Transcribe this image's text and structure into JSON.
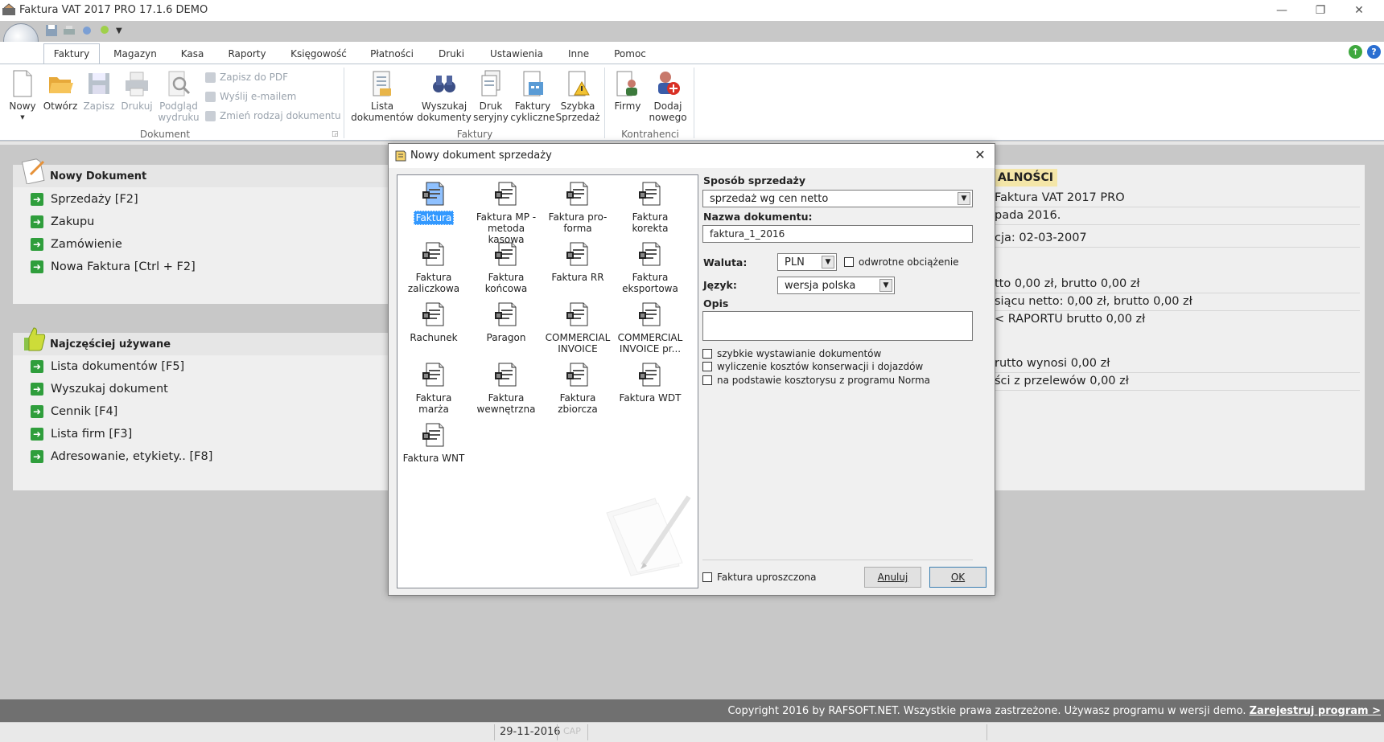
{
  "window": {
    "title": "Faktura VAT 2017 PRO 17.1.6 DEMO",
    "minimize": "—",
    "restore": "❐",
    "close": "✕"
  },
  "ribbon_tabs": [
    "Faktury",
    "Magazyn",
    "Kasa",
    "Raporty",
    "Księgowość",
    "Płatności",
    "Druki",
    "Ustawienia",
    "Inne",
    "Pomoc"
  ],
  "ribbon": {
    "dokument": {
      "label": "Dokument",
      "nowy": "Nowy",
      "otworz": "Otwórz",
      "zapisz": "Zapisz",
      "drukuj": "Drukuj",
      "podglad_1": "Podgląd",
      "podglad_2": "wydruku",
      "pdf": "Zapisz do PDF",
      "email": "Wyślij e-mailem",
      "zmien": "Zmień rodzaj dokumentu"
    },
    "faktury": {
      "label": "Faktury",
      "lista_1": "Lista",
      "lista_2": "dokumentów",
      "wyszukaj_1": "Wyszukaj",
      "wyszukaj_2": "dokumenty",
      "druk_1": "Druk",
      "druk_2": "seryjny",
      "cykliczne_1": "Faktury",
      "cykliczne_2": "cykliczne",
      "szybka_1": "Szybka",
      "szybka_2": "Sprzedaż"
    },
    "kontrahenci": {
      "label": "Kontrahenci",
      "firmy": "Firmy",
      "dodaj_1": "Dodaj",
      "dodaj_2": "nowego"
    }
  },
  "nowy_dokument": {
    "title": "Nowy Dokument",
    "items": [
      "Sprzedaży [F2]",
      "Zakupu",
      "Zamówienie",
      "Nowa Faktura [Ctrl + F2]"
    ]
  },
  "najczesciej": {
    "title": "Najczęściej używane",
    "items": [
      "Lista dokumentów [F5]",
      "Wyszukaj dokument",
      "Cennik [F4]",
      "Lista firm [F3]",
      "Adresowanie, etykiety.. [F8]"
    ]
  },
  "news": {
    "head": "ALNOŚCI",
    "lines": [
      "Faktura VAT 2017 PRO",
      "pada 2016.",
      "cja: 02-03-2007",
      "tto 0,00 zł, brutto 0,00 zł",
      "siącu netto: 0,00 zł, brutto 0,00 zł",
      "< RAPORTU brutto 0,00 zł",
      "rutto wynosi 0,00 zł",
      "ści z przelewów 0,00 zł"
    ]
  },
  "dialog": {
    "title": "Nowy dokument sprzedaży",
    "doc_types": [
      "Faktura",
      "Faktura MP - metoda kasowa",
      "Faktura pro-forma",
      "Faktura korekta",
      "Faktura zaliczkowa",
      "Faktura końcowa",
      "Faktura RR",
      "Faktura eksportowa",
      "Rachunek",
      "Paragon",
      "COMMERCIAL INVOICE",
      "COMMERCIAL INVOICE pr...",
      "Faktura marża",
      "Faktura wewnętrzna",
      "Faktura zbiorcza",
      "Faktura WDT",
      "Faktura WNT"
    ],
    "selected": "Faktura",
    "sposob_label": "Sposób sprzedaży",
    "sposob_value": "sprzedaż wg cen netto",
    "nazwa_label": "Nazwa dokumentu:",
    "nazwa_value": "faktura_1_2016",
    "waluta_label": "Waluta:",
    "waluta_value": "PLN",
    "odwrotne": "odwrotne obciążenie",
    "jezyk_label": "Język:",
    "jezyk_value": "wersja polska",
    "opis_label": "Opis",
    "opis_value": "",
    "opt1": "szybkie wystawianie dokumentów",
    "opt2": "wyliczenie kosztów konserwacji i dojazdów",
    "opt3": "na podstawie kosztorysu z programu Norma",
    "uproszczona": "Faktura uproszczona",
    "anuluj": "Anuluj",
    "ok": "OK"
  },
  "footer": {
    "copyright": "Copyright 2016 by RAFSOFT.NET. Wszystkie prawa zastrzeżone. Używasz programu w wersji demo. ",
    "register": "Zarejestruj program >",
    "date": "29-11-2016",
    "caps": "CAP"
  },
  "colors": {
    "accent": "#3399ff",
    "link_arrow": "#2f9e3c",
    "news_highlight": "#f4e6a8"
  }
}
